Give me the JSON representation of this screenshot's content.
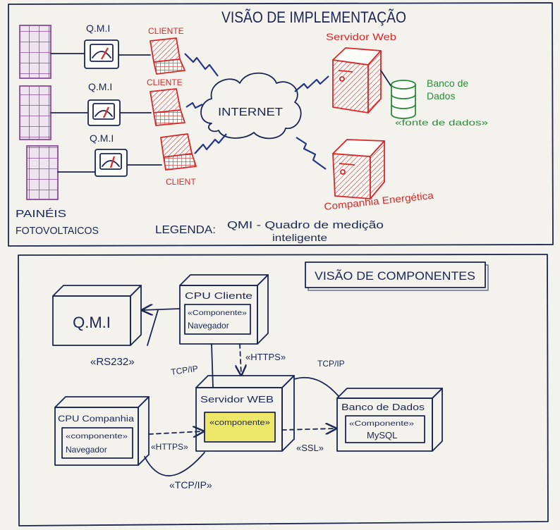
{
  "implementation_view": {
    "title": "VISÃO DE IMPLEMENTAÇÃO",
    "smart_meters": [
      "Q.M.I",
      "Q.M.I",
      "Q.M.I"
    ],
    "clients": [
      "CLIENTE",
      "CLIENTE",
      "CLIENT"
    ],
    "internet": "INTERNET",
    "web_server": "Servidor Web",
    "database": {
      "line1": "Banco de",
      "line2": "Dados",
      "stereotype": "«fonte de dados»"
    },
    "energy_company": "Companhia Energética",
    "solar_panels": {
      "line1": "PAINÉIS",
      "line2": "FOTOVOLTAICOS"
    },
    "legend": {
      "prefix": "LEGENDA:",
      "line1": "QMI - Quadro de medição",
      "line2": "inteligente"
    }
  },
  "component_view": {
    "title": "VISÃO DE COMPONENTES",
    "nodes": {
      "qmi": {
        "name": "Q.M.I"
      },
      "cpu_client": {
        "name": "CPU Cliente",
        "stereotype": "«Componente»",
        "component": "Navegador"
      },
      "web_server": {
        "name": "Servidor WEB",
        "stereotype": "«componente»"
      },
      "cpu_company": {
        "name": "CPU Companhia",
        "stereotype": "«componente»",
        "component": "Navegador"
      },
      "database": {
        "name": "Banco de Dados",
        "stereotype": "«Componente»",
        "component": "MySQL"
      }
    },
    "connections": {
      "rs232": "«RS232»",
      "client_https": "«HTTPS»",
      "client_tcpip": "TCP/IP",
      "db_tcpip": "TCP/IP",
      "company_https": "«HTTPS»",
      "db_ssl": "«SSL»",
      "company_tcpip": "«TCP/IP»"
    }
  },
  "colors": {
    "ink": "#1c2553",
    "red": "#d8282b",
    "green": "#2b8a3b",
    "purple": "#8a4b98",
    "cloud": "#9fc0ec",
    "node_fill": "#b7e08c",
    "node_hatch": "#62b246",
    "component_yellow": "#eee86a",
    "paper": "#f3f2ed"
  }
}
